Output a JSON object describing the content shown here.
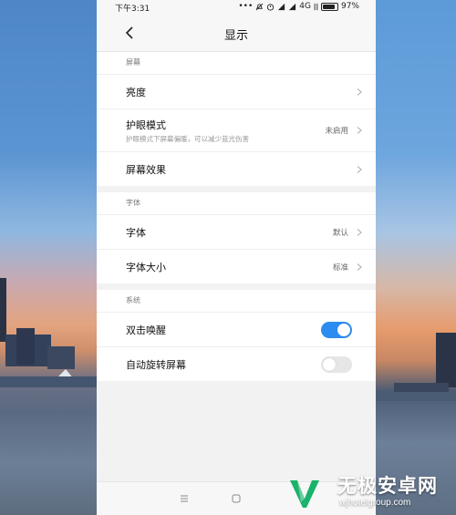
{
  "status_bar": {
    "time": "下午3:31",
    "network": "4G",
    "battery": "97%"
  },
  "header": {
    "title": "显示"
  },
  "sections": [
    {
      "header": "屏幕",
      "rows": [
        {
          "label": "亮度"
        },
        {
          "label": "护眼模式",
          "sublabel": "护眼模式下屏幕偏暖，可以减少蓝光伤害",
          "value": "未启用"
        },
        {
          "label": "屏幕效果"
        }
      ]
    },
    {
      "header": "字体",
      "rows": [
        {
          "label": "字体",
          "value": "默认"
        },
        {
          "label": "字体大小",
          "value": "标准"
        }
      ]
    },
    {
      "header": "系统",
      "rows": [
        {
          "label": "双击唤醒",
          "toggle_on": true
        },
        {
          "label": "自动旋转屏幕",
          "toggle_on": false
        }
      ]
    }
  ],
  "colors": {
    "toggle_on": "#2d8cf0",
    "toggle_off": "#e6e6e6"
  },
  "watermark": {
    "title": "无极安卓网",
    "url": "wjhotelgroup.com"
  }
}
